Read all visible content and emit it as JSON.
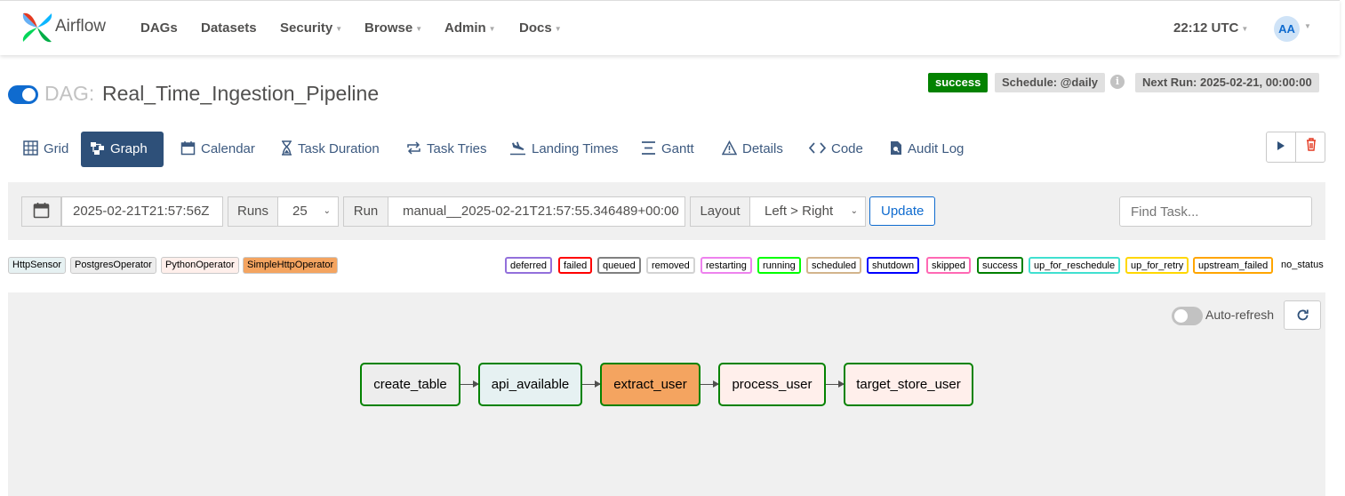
{
  "navbar": {
    "brand": "Airflow",
    "items": [
      {
        "label": "DAGs",
        "dropdown": false
      },
      {
        "label": "Datasets",
        "dropdown": false
      },
      {
        "label": "Security",
        "dropdown": true
      },
      {
        "label": "Browse",
        "dropdown": true
      },
      {
        "label": "Admin",
        "dropdown": true
      },
      {
        "label": "Docs",
        "dropdown": true
      }
    ],
    "clock": "22:12 UTC",
    "avatar": "AA"
  },
  "dag": {
    "prefix": "DAG:",
    "id": "Real_Time_Ingestion_Pipeline",
    "paused": false,
    "status": "success",
    "schedule": "Schedule: @daily",
    "info_icon": "i",
    "next_run": "Next Run: 2025-02-21, 00:00:00"
  },
  "tabs": [
    {
      "label": "Grid",
      "icon": "grid-icon",
      "active": false
    },
    {
      "label": "Graph",
      "icon": "graph-icon",
      "active": true
    },
    {
      "label": "Calendar",
      "icon": "calendar-icon",
      "active": false
    },
    {
      "label": "Task Duration",
      "icon": "hourglass-icon",
      "active": false
    },
    {
      "label": "Task Tries",
      "icon": "retry-icon",
      "active": false
    },
    {
      "label": "Landing Times",
      "icon": "plane-landing-icon",
      "active": false
    },
    {
      "label": "Gantt",
      "icon": "gantt-icon",
      "active": false
    },
    {
      "label": "Details",
      "icon": "warning-triangle-icon",
      "active": false
    },
    {
      "label": "Code",
      "icon": "code-icon",
      "active": false
    },
    {
      "label": "Audit Log",
      "icon": "audit-file-icon",
      "active": false
    }
  ],
  "filters": {
    "base_date": "2025-02-21T21:57:56Z",
    "runs_label": "Runs",
    "runs_value": "25",
    "run_label": "Run",
    "run_value": "manual__2025-02-21T21:57:55.346489+00:00",
    "layout_label": "Layout",
    "layout_value": "Left > Right",
    "update_label": "Update",
    "find_placeholder": "Find Task..."
  },
  "operator_legend": [
    {
      "label": "HttpSensor",
      "color": "#e6f1f2"
    },
    {
      "label": "PostgresOperator",
      "color": "#ededed"
    },
    {
      "label": "PythonOperator",
      "color": "#ffefeb"
    },
    {
      "label": "SimpleHttpOperator",
      "color": "#f4a460"
    }
  ],
  "state_legend": [
    {
      "label": "deferred",
      "color": "#9370db"
    },
    {
      "label": "failed",
      "color": "#ff0000"
    },
    {
      "label": "queued",
      "color": "#808080"
    },
    {
      "label": "removed",
      "color": "#d3d3d3"
    },
    {
      "label": "restarting",
      "color": "#ee82ee"
    },
    {
      "label": "running",
      "color": "#00ff00"
    },
    {
      "label": "scheduled",
      "color": "#d2b48c"
    },
    {
      "label": "shutdown",
      "color": "#0000ff"
    },
    {
      "label": "skipped",
      "color": "#ff69b4"
    },
    {
      "label": "success",
      "color": "#008000"
    },
    {
      "label": "up_for_reschedule",
      "color": "#40e0d0"
    },
    {
      "label": "up_for_retry",
      "color": "#ffd700"
    },
    {
      "label": "upstream_failed",
      "color": "#ffa500"
    }
  ],
  "no_status": "no_status",
  "graph": {
    "auto_refresh_label": "Auto-refresh",
    "auto_refresh_on": false,
    "nodes": [
      {
        "label": "create_table",
        "fill": "#ededed"
      },
      {
        "label": "api_available",
        "fill": "#e6f1f2"
      },
      {
        "label": "extract_user",
        "fill": "#f4a460"
      },
      {
        "label": "process_user",
        "fill": "#ffefeb"
      },
      {
        "label": "target_store_user",
        "fill": "#ffefeb"
      }
    ],
    "node_border_color": "#038200"
  }
}
